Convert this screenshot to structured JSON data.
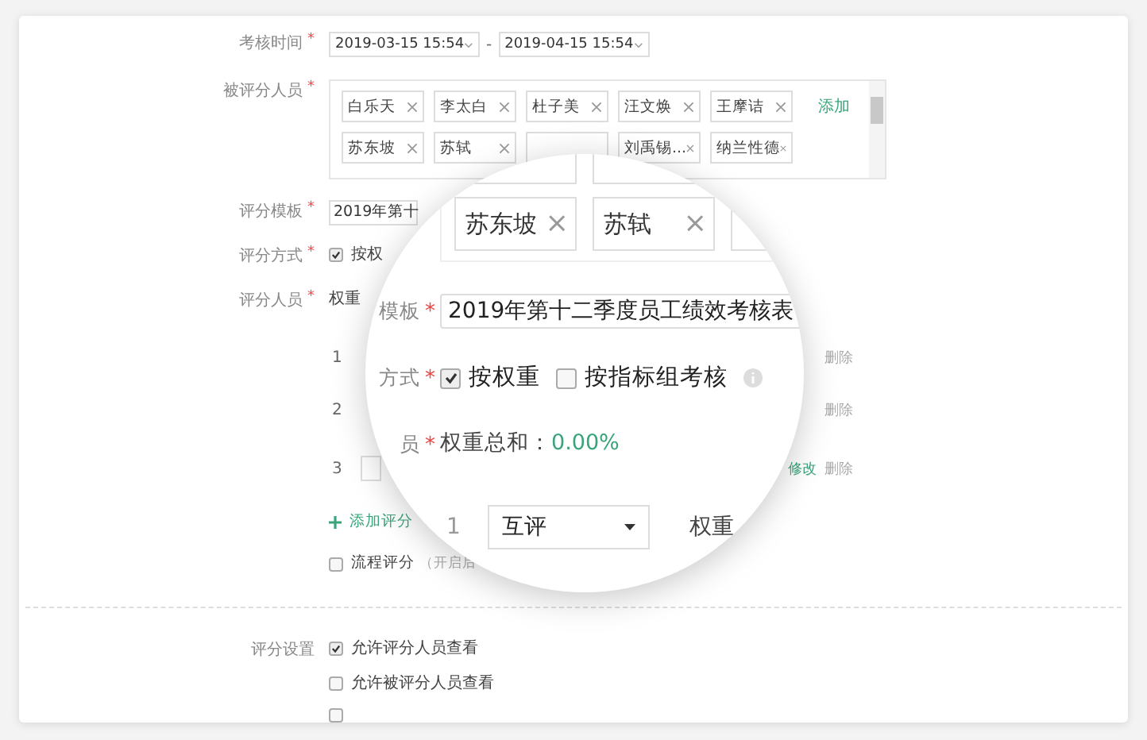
{
  "form": {
    "period": {
      "label": "考核时间",
      "required_mark": "*",
      "start": "2019-03-15 15:54",
      "separator": "-",
      "end": "2019-04-15 15:54"
    },
    "evaluees": {
      "label": "被评分人员",
      "required_mark": "*",
      "add_link": "添加",
      "tags": [
        {
          "kind": "tag",
          "name": "白乐天"
        },
        {
          "kind": "tag",
          "name": "李太白"
        },
        {
          "kind": "tag",
          "name": "杜子美"
        },
        {
          "kind": "tag",
          "name": "汪文焕"
        },
        {
          "kind": "tag",
          "name": "王摩诘"
        },
        {
          "kind": "tag",
          "name": "苏东坡"
        },
        {
          "kind": "tag",
          "name": "苏轼"
        },
        {
          "kind": "covered"
        },
        {
          "kind": "tag",
          "name": "刘禹锡..."
        },
        {
          "kind": "tag",
          "name": "纳兰性德"
        }
      ]
    },
    "template": {
      "label": "评分模板",
      "required_mark": "*",
      "value": "2019年第十"
    },
    "method": {
      "label": "评分方式",
      "required_mark": "*",
      "options": [
        {
          "label": "按权",
          "checked": true
        }
      ]
    },
    "raters": {
      "label": "评分人员",
      "required_mark": "*",
      "weight_label": "权重",
      "rows": [
        {
          "kind": "plain",
          "index": "1",
          "delete": "删除"
        },
        {
          "kind": "plain",
          "index": "2",
          "delete": "删除"
        },
        {
          "kind": "with_field",
          "index": "3",
          "edit": "修改",
          "delete": "删除"
        }
      ],
      "add": "添加评分"
    },
    "flow": {
      "label": "流程评分",
      "checked": false,
      "hint": "（开启后"
    },
    "settings": {
      "label": "评分设置",
      "options": [
        {
          "label": "允许评分人员查看",
          "checked": true
        },
        {
          "label": "允许被评分人员查看",
          "checked": false
        },
        {
          "checked": false
        }
      ]
    }
  },
  "magnifier": {
    "tags": [
      {
        "name": "苏东坡"
      },
      {
        "name": "苏轼"
      }
    ],
    "template": {
      "label": "模板",
      "required_mark": "*",
      "value": "2019年第十二季度员工绩效考核表"
    },
    "method": {
      "label": "方式",
      "required_mark": "*",
      "options": [
        {
          "label": "按权重",
          "checked": true
        },
        {
          "label": "按指标组考核",
          "checked": false
        }
      ]
    },
    "raters": {
      "label": "员",
      "required_mark": "*",
      "weight_total_label": "权重总和：",
      "weight_total": "0.00%"
    },
    "row": {
      "index": "1",
      "type": "互评",
      "weight_label": "权重"
    }
  }
}
